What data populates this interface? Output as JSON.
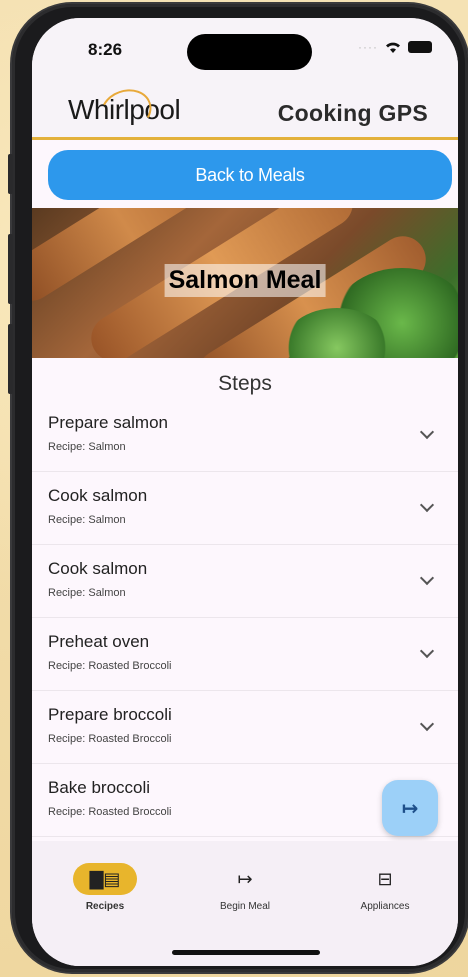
{
  "status": {
    "time": "8:26"
  },
  "header": {
    "brand": "Whirlpool",
    "title": "Cooking GPS"
  },
  "actions": {
    "back_label": "Back to Meals"
  },
  "meal": {
    "title": "Salmon Meal"
  },
  "steps_heading": "Steps",
  "steps": [
    {
      "title": "Prepare salmon",
      "recipe": "Recipe: Salmon"
    },
    {
      "title": "Cook salmon",
      "recipe": "Recipe: Salmon"
    },
    {
      "title": "Cook salmon",
      "recipe": "Recipe: Salmon"
    },
    {
      "title": "Preheat oven",
      "recipe": "Recipe: Roasted Broccoli"
    },
    {
      "title": "Prepare broccoli",
      "recipe": "Recipe: Roasted Broccoli"
    },
    {
      "title": "Bake broccoli",
      "recipe": "Recipe: Roasted Broccoli"
    }
  ],
  "fab": {
    "icon": "begin-arrow-icon",
    "glyph": "↦"
  },
  "nav": {
    "items": [
      {
        "label": "Recipes",
        "icon": "book-icon",
        "glyph": "▇▤",
        "active": true
      },
      {
        "label": "Begin Meal",
        "icon": "begin-arrow-icon",
        "glyph": "↦",
        "active": false
      },
      {
        "label": "Appliances",
        "icon": "fridge-icon",
        "glyph": "⊟",
        "active": false
      }
    ]
  },
  "colors": {
    "accent": "#e8b52c",
    "primary": "#2d98ec",
    "fab": "#9cd0f8"
  }
}
